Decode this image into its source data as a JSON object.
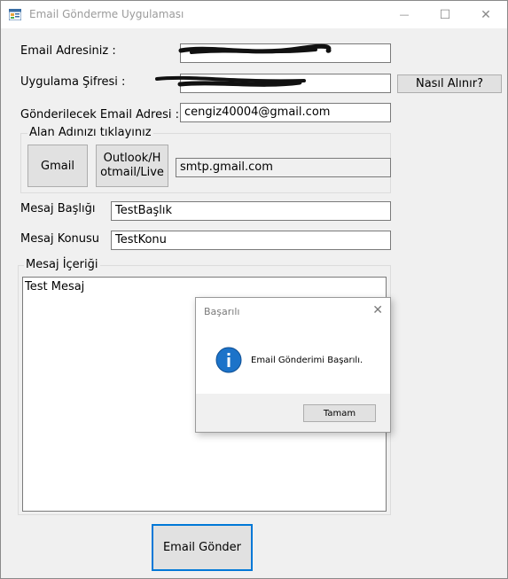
{
  "window": {
    "title": "Email Gönderme Uygulaması",
    "icon": "app-form-icon",
    "minimize_glyph": "—",
    "maximize_glyph": "☐",
    "close_glyph": "✕"
  },
  "form": {
    "email_label": "Email Adresiniz :",
    "password_label": "Uygulama Şifresi :",
    "how_to_get_button": "Nasıl Alınır?",
    "recipient_label": "Gönderilecek Email Adresi :",
    "recipient_value": "cengiz40004@gmail.com",
    "domain_group_label": "Alan Adınızı tıklayınız",
    "gmail_button": "Gmail",
    "outlook_button_line1": "Outlook/H",
    "outlook_button_line2": "otmail/Live",
    "smtp_value": "smtp.gmail.com",
    "subject_label": "Mesaj Başlığı",
    "subject_value": "TestBaşlık",
    "topic_label": "Mesaj Konusu",
    "topic_value": "TestKonu",
    "content_group_label": "Mesaj İçeriği",
    "content_value": "Test Mesaj",
    "send_button": "Email Gönder"
  },
  "dialog": {
    "title": "Başarılı",
    "message": "Email Gönderimi Başarılı.",
    "ok_button": "Tamam",
    "icon": "info-icon"
  },
  "colors": {
    "accent_border": "#0078d7",
    "info_icon": "#1c73c9"
  }
}
